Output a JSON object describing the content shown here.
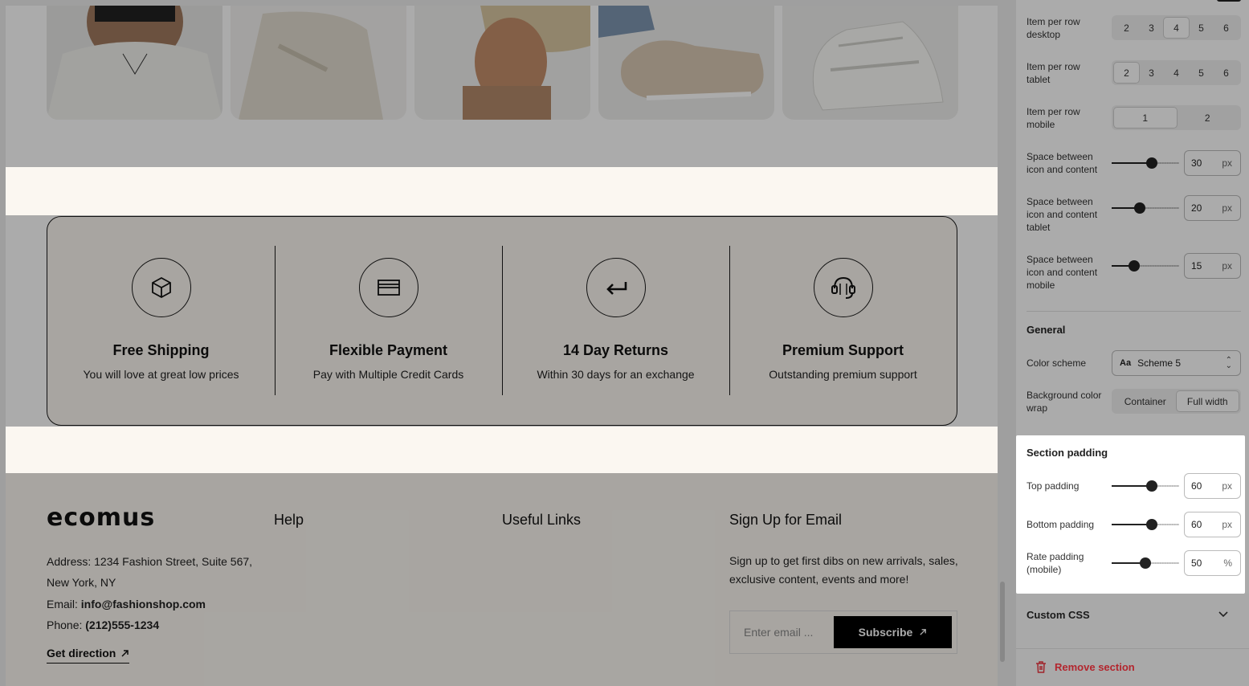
{
  "features": [
    {
      "icon": "box-icon",
      "title": "Free Shipping",
      "desc": "You will love at great low prices"
    },
    {
      "icon": "credit-card-icon",
      "title": "Flexible Payment",
      "desc": "Pay with Multiple Credit Cards"
    },
    {
      "icon": "return-arrow-icon",
      "title": "14 Day Returns",
      "desc": "Within 30 days for an exchange"
    },
    {
      "icon": "headset-icon",
      "title": "Premium Support",
      "desc": "Outstanding premium support"
    }
  ],
  "footer": {
    "logo": "ecomus",
    "address_line1": "Address: 1234 Fashion Street, Suite 567,",
    "address_line2": "New York, NY",
    "email_label": "Email: ",
    "email_value": "info@fashionshop.com",
    "phone_label": "Phone: ",
    "phone_value": "(212)555-1234",
    "get_direction": "Get direction",
    "help_title": "Help",
    "links_title": "Useful Links",
    "signup_title": "Sign Up for Email",
    "signup_text": "Sign up to get first dibs on new arrivals, sales, exclusive content, events and more!",
    "email_placeholder": "Enter email ...",
    "subscribe": "Subscribe"
  },
  "panel": {
    "per_row_desktop": {
      "label": "Item per row desktop",
      "options": [
        "2",
        "3",
        "4",
        "5",
        "6"
      ],
      "selected": "4"
    },
    "per_row_tablet": {
      "label": "Item per row tablet",
      "options": [
        "2",
        "3",
        "4",
        "5",
        "6"
      ],
      "selected": "2"
    },
    "per_row_mobile": {
      "label": "Item per row mobile",
      "options": [
        "1",
        "2"
      ],
      "selected": "1"
    },
    "space_desktop": {
      "label": "Space between icon and content",
      "value": "30",
      "unit": "px",
      "level": 0.6
    },
    "space_tablet": {
      "label": "Space between icon and content tablet",
      "value": "20",
      "unit": "px",
      "level": 0.42
    },
    "space_mobile": {
      "label": "Space between icon and content mobile",
      "value": "15",
      "unit": "px",
      "level": 0.33
    },
    "general_heading": "General",
    "color_scheme_label": "Color scheme",
    "color_scheme_value": "Scheme 5",
    "bg_wrap_label": "Background color wrap",
    "bg_wrap_options": [
      "Container",
      "Full width"
    ],
    "bg_wrap_selected": "Full width",
    "section_padding_heading": "Section padding",
    "top_padding": {
      "label": "Top padding",
      "value": "60",
      "unit": "px",
      "level": 0.6
    },
    "bottom_padding": {
      "label": "Bottom padding",
      "value": "60",
      "unit": "px",
      "level": 0.6
    },
    "rate_padding": {
      "label": "Rate padding (mobile)",
      "value": "50",
      "unit": "%",
      "level": 0.5
    },
    "custom_css": "Custom CSS",
    "remove_section": "Remove section"
  }
}
